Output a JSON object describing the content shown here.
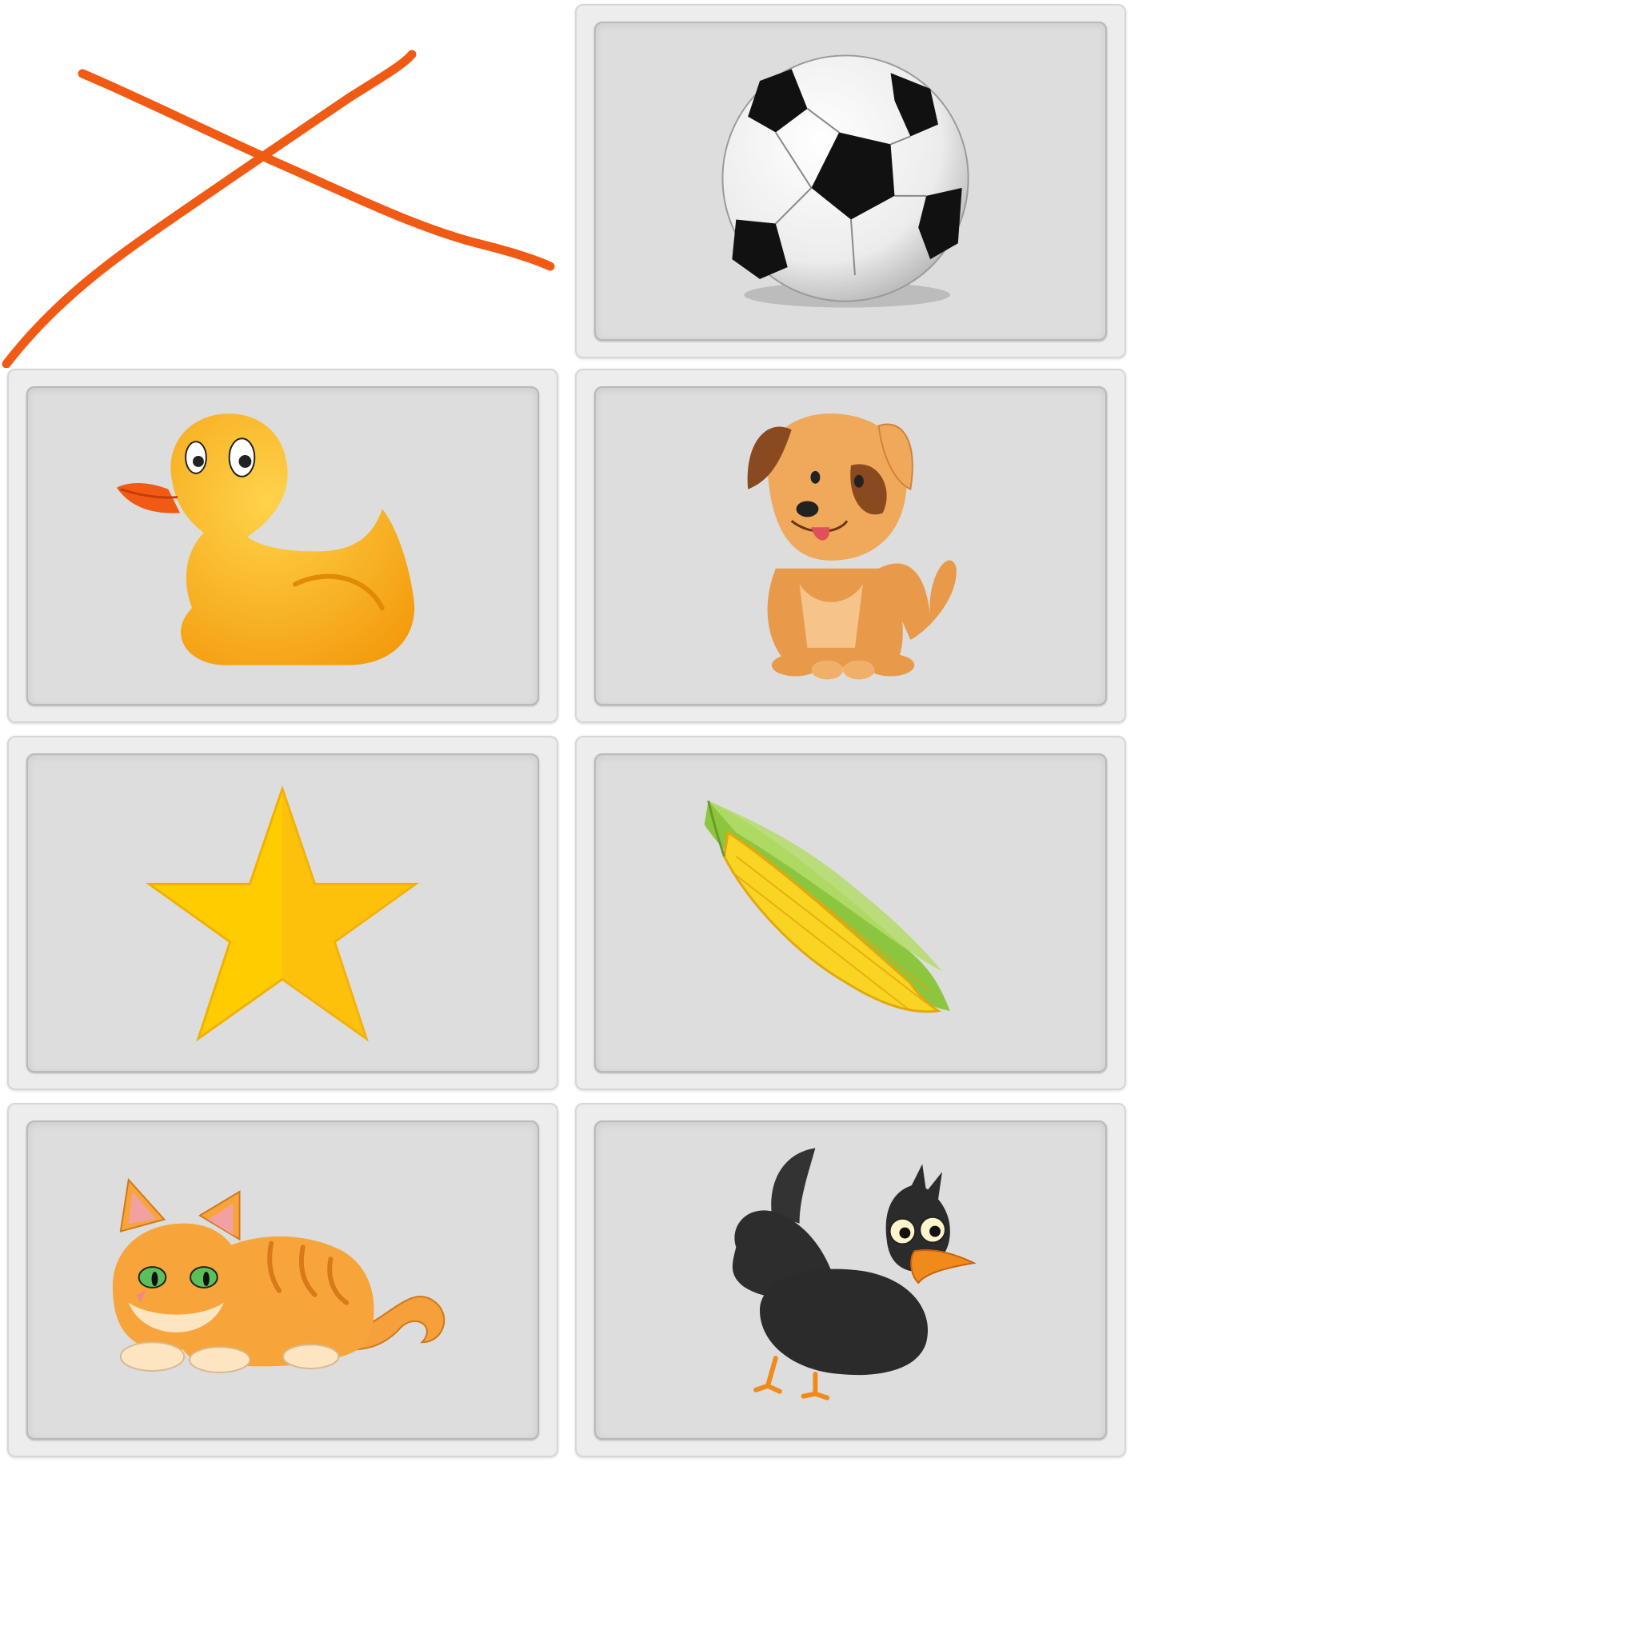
{
  "board": {
    "columns": 2,
    "rows": 4,
    "removed_slot_mark": "cross-mark",
    "mark_color": "#f05a14",
    "cards": [
      {
        "slot": 0,
        "icon": "crossed-out-empty-slot",
        "removed": true
      },
      {
        "slot": 1,
        "icon": "soccer-ball-icon"
      },
      {
        "slot": 2,
        "icon": "rubber-duck-icon"
      },
      {
        "slot": 3,
        "icon": "puppy-dog-icon"
      },
      {
        "slot": 4,
        "icon": "star-icon"
      },
      {
        "slot": 5,
        "icon": "corn-cob-icon"
      },
      {
        "slot": 6,
        "icon": "orange-cat-icon"
      },
      {
        "slot": 7,
        "icon": "black-crow-icon"
      }
    ]
  }
}
